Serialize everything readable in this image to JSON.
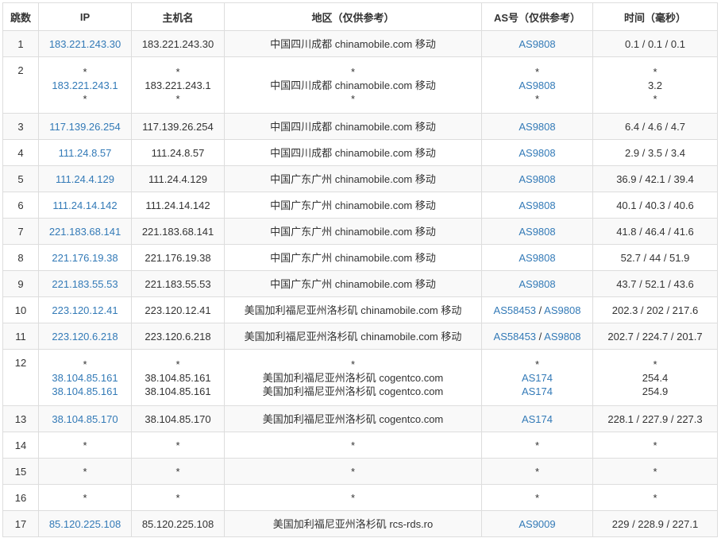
{
  "headers": {
    "hop": "跳数",
    "ip": "IP",
    "host": "主机名",
    "region": "地区（仅供参考）",
    "as": "AS号（仅供参考）",
    "time": "时间（毫秒）"
  },
  "rows": [
    {
      "hop": "1",
      "ip": [
        "183.221.243.30"
      ],
      "host": [
        "183.221.243.30"
      ],
      "region": [
        "中国四川成都 chinamobile.com 移动"
      ],
      "as": [
        [
          "AS9808"
        ]
      ],
      "time": [
        "0.1 / 0.1 / 0.1"
      ]
    },
    {
      "hop": "2",
      "ip": [
        "*",
        "183.221.243.1",
        "*"
      ],
      "host": [
        "*",
        "183.221.243.1",
        "*"
      ],
      "region": [
        "*",
        "中国四川成都 chinamobile.com 移动",
        "*"
      ],
      "as": [
        [
          "*"
        ],
        [
          "AS9808"
        ],
        [
          "*"
        ]
      ],
      "time": [
        "*",
        "3.2",
        "*"
      ]
    },
    {
      "hop": "3",
      "ip": [
        "117.139.26.254"
      ],
      "host": [
        "117.139.26.254"
      ],
      "region": [
        "中国四川成都 chinamobile.com 移动"
      ],
      "as": [
        [
          "AS9808"
        ]
      ],
      "time": [
        "6.4 / 4.6 / 4.7"
      ]
    },
    {
      "hop": "4",
      "ip": [
        "111.24.8.57"
      ],
      "host": [
        "111.24.8.57"
      ],
      "region": [
        "中国四川成都 chinamobile.com 移动"
      ],
      "as": [
        [
          "AS9808"
        ]
      ],
      "time": [
        "2.9 / 3.5 / 3.4"
      ]
    },
    {
      "hop": "5",
      "ip": [
        "111.24.4.129"
      ],
      "host": [
        "111.24.4.129"
      ],
      "region": [
        "中国广东广州 chinamobile.com 移动"
      ],
      "as": [
        [
          "AS9808"
        ]
      ],
      "time": [
        "36.9 / 42.1 / 39.4"
      ]
    },
    {
      "hop": "6",
      "ip": [
        "111.24.14.142"
      ],
      "host": [
        "111.24.14.142"
      ],
      "region": [
        "中国广东广州 chinamobile.com 移动"
      ],
      "as": [
        [
          "AS9808"
        ]
      ],
      "time": [
        "40.1 / 40.3 / 40.6"
      ]
    },
    {
      "hop": "7",
      "ip": [
        "221.183.68.141"
      ],
      "host": [
        "221.183.68.141"
      ],
      "region": [
        "中国广东广州 chinamobile.com 移动"
      ],
      "as": [
        [
          "AS9808"
        ]
      ],
      "time": [
        "41.8 / 46.4 / 41.6"
      ]
    },
    {
      "hop": "8",
      "ip": [
        "221.176.19.38"
      ],
      "host": [
        "221.176.19.38"
      ],
      "region": [
        "中国广东广州 chinamobile.com 移动"
      ],
      "as": [
        [
          "AS9808"
        ]
      ],
      "time": [
        "52.7 / 44 / 51.9"
      ]
    },
    {
      "hop": "9",
      "ip": [
        "221.183.55.53"
      ],
      "host": [
        "221.183.55.53"
      ],
      "region": [
        "中国广东广州 chinamobile.com 移动"
      ],
      "as": [
        [
          "AS9808"
        ]
      ],
      "time": [
        "43.7 / 52.1 / 43.6"
      ]
    },
    {
      "hop": "10",
      "ip": [
        "223.120.12.41"
      ],
      "host": [
        "223.120.12.41"
      ],
      "region": [
        "美国加利福尼亚州洛杉矶 chinamobile.com 移动"
      ],
      "as": [
        [
          "AS58453",
          "AS9808"
        ]
      ],
      "time": [
        "202.3 / 202 / 217.6"
      ]
    },
    {
      "hop": "11",
      "ip": [
        "223.120.6.218"
      ],
      "host": [
        "223.120.6.218"
      ],
      "region": [
        "美国加利福尼亚州洛杉矶 chinamobile.com 移动"
      ],
      "as": [
        [
          "AS58453",
          "AS9808"
        ]
      ],
      "time": [
        "202.7 / 224.7 / 201.7"
      ]
    },
    {
      "hop": "12",
      "ip": [
        "*",
        "38.104.85.161",
        "38.104.85.161"
      ],
      "host": [
        "*",
        "38.104.85.161",
        "38.104.85.161"
      ],
      "region": [
        "*",
        "美国加利福尼亚州洛杉矶 cogentco.com",
        "美国加利福尼亚州洛杉矶 cogentco.com"
      ],
      "as": [
        [
          "*"
        ],
        [
          "AS174"
        ],
        [
          "AS174"
        ]
      ],
      "time": [
        "*",
        "254.4",
        "254.9"
      ]
    },
    {
      "hop": "13",
      "ip": [
        "38.104.85.170"
      ],
      "host": [
        "38.104.85.170"
      ],
      "region": [
        "美国加利福尼亚州洛杉矶 cogentco.com"
      ],
      "as": [
        [
          "AS174"
        ]
      ],
      "time": [
        "228.1 / 227.9 / 227.3"
      ]
    },
    {
      "hop": "14",
      "ip": [
        "*"
      ],
      "host": [
        "*"
      ],
      "region": [
        "*"
      ],
      "as": [
        [
          "*"
        ]
      ],
      "time": [
        "*"
      ]
    },
    {
      "hop": "15",
      "ip": [
        "*"
      ],
      "host": [
        "*"
      ],
      "region": [
        "*"
      ],
      "as": [
        [
          "*"
        ]
      ],
      "time": [
        "*"
      ]
    },
    {
      "hop": "16",
      "ip": [
        "*"
      ],
      "host": [
        "*"
      ],
      "region": [
        "*"
      ],
      "as": [
        [
          "*"
        ]
      ],
      "time": [
        "*"
      ]
    },
    {
      "hop": "17",
      "ip": [
        "85.120.225.108"
      ],
      "host": [
        "85.120.225.108"
      ],
      "region": [
        "美国加利福尼亚州洛杉矶 rcs-rds.ro"
      ],
      "as": [
        [
          "AS9009"
        ]
      ],
      "time": [
        "229 / 228.9 / 227.1"
      ]
    }
  ],
  "colors": {
    "link": "#337ab7",
    "border": "#dddddd",
    "stripe": "#f9f9f9",
    "text": "#333333"
  }
}
